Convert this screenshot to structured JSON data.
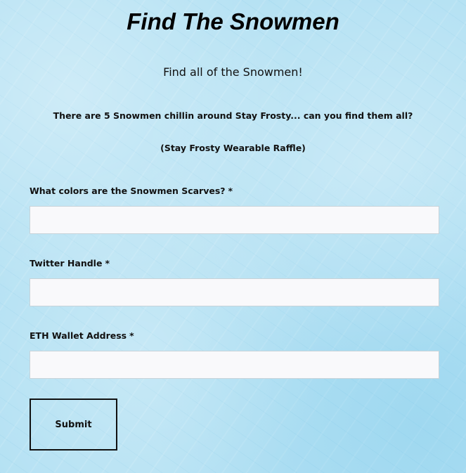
{
  "form": {
    "title": "Find The Snowmen",
    "subtitle": "Find all of the Snowmen!",
    "description": "There are 5 Snowmen chillin around Stay Frosty... can you find them all?",
    "note": "(Stay Frosty Wearable Raffle)",
    "required_marker": "*",
    "fields": [
      {
        "label": "What colors are the Snowmen Scarves?",
        "value": "",
        "placeholder": ""
      },
      {
        "label": "Twitter Handle",
        "value": "",
        "placeholder": ""
      },
      {
        "label": "ETH Wallet Address",
        "value": "",
        "placeholder": ""
      }
    ],
    "submit_label": "Submit"
  },
  "colors": {
    "background": "#b4e1f3",
    "input_background": "#f9f9fb",
    "text": "#111111"
  }
}
